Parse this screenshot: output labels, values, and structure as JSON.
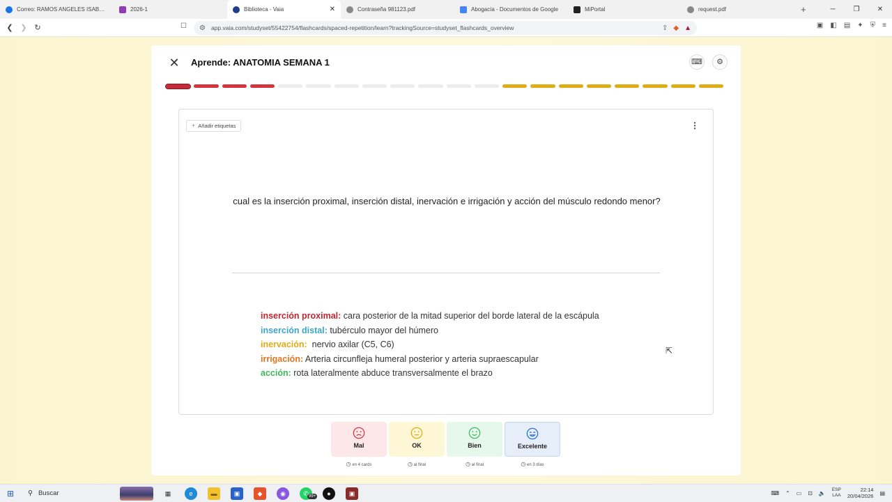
{
  "browser": {
    "tabs": [
      {
        "label": "Correo: RAMOS ANGELES ISABEL CH",
        "color": "#1a73e8",
        "active": false
      },
      {
        "label": "2026-1",
        "color": "#8e3bb5",
        "active": false
      },
      {
        "label": "Biblioteca - Vaia",
        "color": "#1d3c8f",
        "active": true
      },
      {
        "label": "Contraseña 981123.pdf",
        "color": "#888888",
        "active": false
      },
      {
        "label": "Abogacía - Documentos de Google",
        "color": "#4285f4",
        "active": false
      },
      {
        "label": "MiPortal",
        "color": "#222222",
        "active": false
      },
      {
        "label": "request.pdf",
        "color": "#888888",
        "active": false
      }
    ],
    "url": "app.vaia.com/studyset/55422754/flashcards/spaced-repetition/learn?trackingSource=studyset_flashcards_overview"
  },
  "header": {
    "title": "Aprende: ANATOMIA SEMANA 1"
  },
  "progress": {
    "segments": [
      "current",
      "bad",
      "bad",
      "bad",
      "empty",
      "empty",
      "empty",
      "empty",
      "empty",
      "empty",
      "empty",
      "empty",
      "gold",
      "gold",
      "gold",
      "gold",
      "gold",
      "gold",
      "gold",
      "gold"
    ]
  },
  "card": {
    "add_tags_label": "Añadir etiquetas",
    "question": "cual es la inserción proximal, inserción distal, inervación e irrigación y acción del músculo redondo menor?",
    "answer": [
      {
        "key": "inserción proximal:",
        "value": " cara posterior de la mitad superior del borde lateral de la escápula",
        "color": "#c0262f"
      },
      {
        "key": "inserción distal:",
        "value": " tubérculo mayor del húmero",
        "color": "#3aa6c9"
      },
      {
        "key": "inervación:",
        "value": "  nervio axilar (C5, C6)",
        "color": "#e0ac14"
      },
      {
        "key": "irrigación:",
        "value": " Arteria circunfleja humeral posterior y arteria supraescapular",
        "color": "#e0761f"
      },
      {
        "key": "acción:",
        "value": " rota lateralmente abduce transversalmente el brazo",
        "color": "#3cb85a"
      }
    ]
  },
  "ratings": [
    {
      "label": "Mal",
      "sub": "en 4 cards",
      "color": "#d5343f"
    },
    {
      "label": "OK",
      "sub": "al final",
      "color": "#e0ac14"
    },
    {
      "label": "Bien",
      "sub": "al final",
      "color": "#3cb85a"
    },
    {
      "label": "Excelente",
      "sub": "en 3 días",
      "color": "#2b6fd1"
    }
  ],
  "taskbar": {
    "search_label": "Buscar",
    "whatsapp_badge": "99+",
    "lang_top": "ESP",
    "lang_bottom": "LAA",
    "time": "22:14",
    "date": "20/04/2026"
  }
}
